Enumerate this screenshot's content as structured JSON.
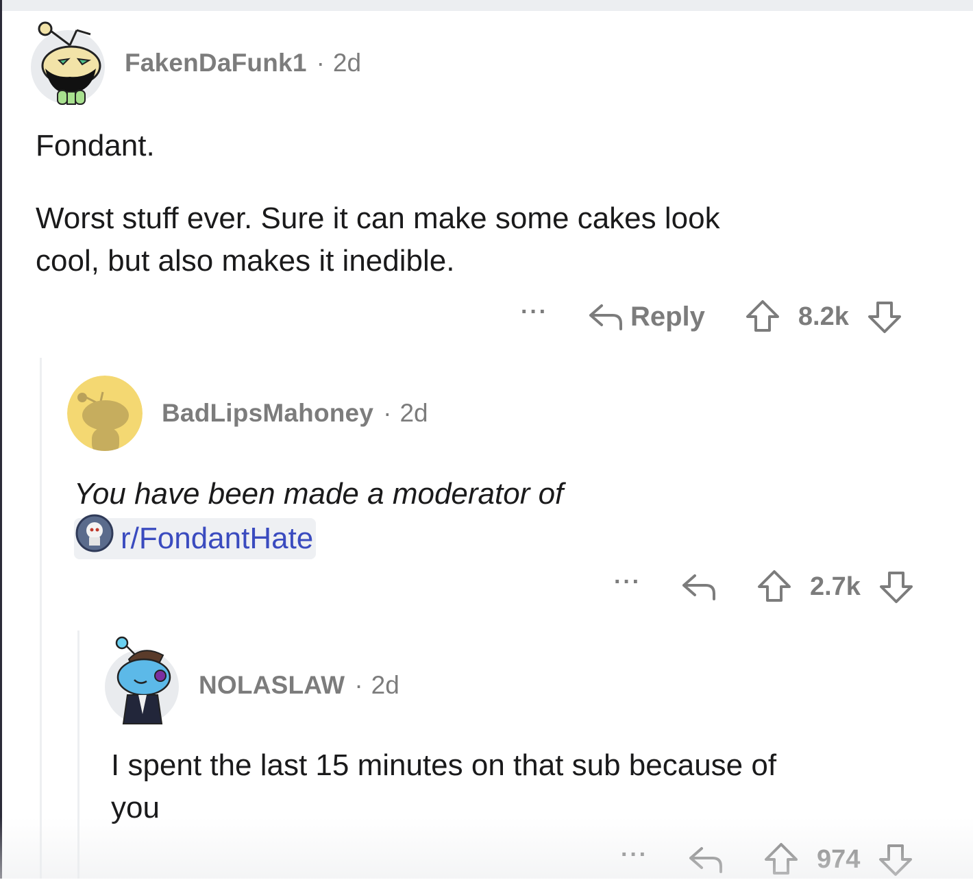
{
  "comments": [
    {
      "username": "FakenDaFunk1",
      "separator": "·",
      "age": "2d",
      "avatar": "snoo-bearded-avatar",
      "paragraphs": [
        "Fondant.",
        "Worst stuff ever. Sure it can make some cakes look",
        "cool, but also makes it inedible."
      ],
      "actions": {
        "more": "···",
        "reply_label": "Reply",
        "score": "8.2k"
      }
    },
    {
      "username": "BadLipsMahoney",
      "separator": "·",
      "age": "2d",
      "avatar": "snoo-default-yellow-avatar",
      "text": "You have been made a moderator of",
      "subreddit_link": "r/FondantHate",
      "actions": {
        "more": "···",
        "score": "2.7k"
      }
    },
    {
      "username": "NOLASLAW",
      "separator": "·",
      "age": "2d",
      "avatar": "snoo-blue-suit-avatar",
      "lines": [
        "I spent the last 15 minutes on that sub because of",
        "you"
      ],
      "actions": {
        "more": "···",
        "score": "974"
      }
    }
  ],
  "icons": {
    "reply": "reply-arrow-icon",
    "upvote": "upvote-arrow-icon",
    "downvote": "downvote-arrow-icon",
    "more": "more-options-icon"
  },
  "colors": {
    "meta_text": "#7c7c7c",
    "body_text": "#1a1a1b",
    "link": "#3a4bbf",
    "thread_line": "#edeff1",
    "chip_bg": "#eef0f3"
  }
}
